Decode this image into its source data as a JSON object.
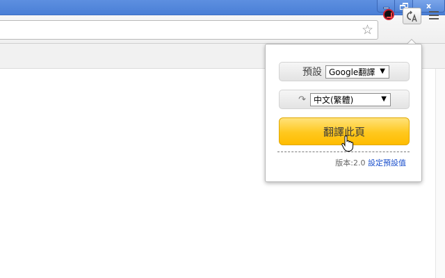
{
  "window": {
    "minimize_label": "",
    "restore_label": "",
    "close_label": "x"
  },
  "toolbar": {
    "bookmark_icon": "star-icon",
    "extension_icons": [
      "red-arrow-extension-icon",
      "translate-extension-icon"
    ],
    "menu_icon": "hamburger-menu-icon"
  },
  "popup": {
    "default_label": "預設",
    "engine_select": "Google翻譯",
    "language_select": "中文(繁體)",
    "translate_button": "翻譯此頁",
    "version_text": "版本:2.0",
    "settings_link": "設定預設值",
    "accent_color": "#ffc81e",
    "link_color": "#1a4fcc"
  }
}
